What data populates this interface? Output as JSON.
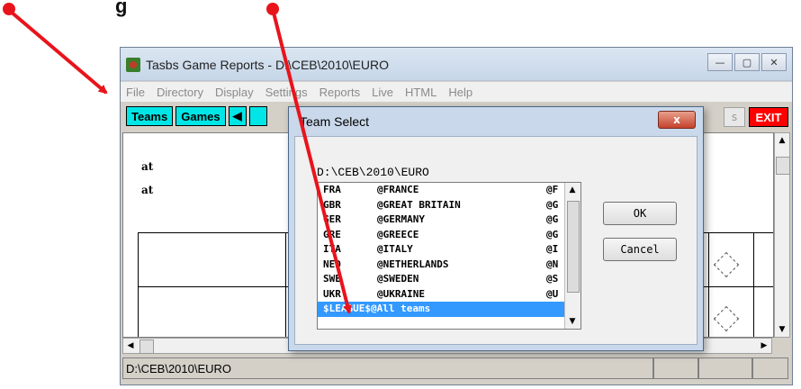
{
  "caption": "g",
  "window": {
    "title": "Tasbs Game Reports - D:\\CEB\\2010\\EURO",
    "min": "—",
    "max": "▢",
    "close": "✕"
  },
  "menu": [
    "File",
    "Directory",
    "Display",
    "Settings",
    "Reports",
    "Live",
    "HTML",
    "Help"
  ],
  "toolbar": {
    "teams": "Teams",
    "games": "Games",
    "prev": "◀",
    "exit": "EXIT",
    "partial": "s"
  },
  "content": {
    "at1": "at",
    "at2": "at"
  },
  "status": {
    "path": "D:\\CEB\\2010\\EURO"
  },
  "dialog": {
    "title": "Team Select",
    "close": "x",
    "path": "D:\\CEB\\2010\\EURO",
    "teams": [
      {
        "code": "FRA",
        "name": "@FRANCE",
        "tail": "@F"
      },
      {
        "code": "GBR",
        "name": "@GREAT BRITAIN",
        "tail": "@G"
      },
      {
        "code": "GER",
        "name": "@GERMANY",
        "tail": "@G"
      },
      {
        "code": "GRE",
        "name": "@GREECE",
        "tail": "@G"
      },
      {
        "code": "ITA",
        "name": "@ITALY",
        "tail": "@I"
      },
      {
        "code": "NED",
        "name": "@NETHERLANDS",
        "tail": "@N"
      },
      {
        "code": "SWE",
        "name": "@SWEDEN",
        "tail": "@S"
      },
      {
        "code": "UKR",
        "name": "@UKRAINE",
        "tail": "@U"
      }
    ],
    "selected": "$LEAGUE$@All teams",
    "ok": "OK",
    "cancel": "Cancel"
  },
  "colors": {
    "annotation": "#e8141c",
    "selection": "#3399ff",
    "toolbar_button": "#00e6e6",
    "exit": "#ff0000"
  }
}
